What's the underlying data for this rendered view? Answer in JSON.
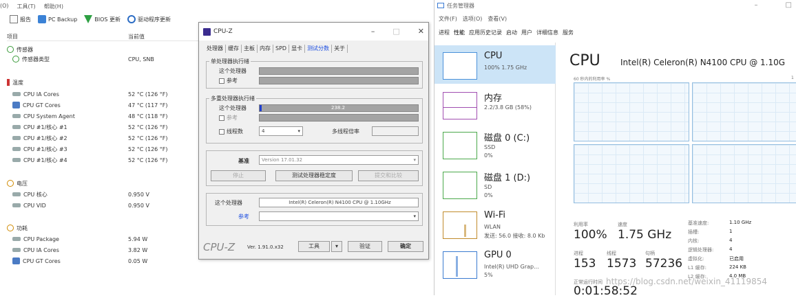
{
  "hwinfo": {
    "menu": [
      "(O)",
      "工具(T)",
      "帮助(H)"
    ],
    "toolbar": [
      "报告",
      "PC Backup",
      "BIOS 更新",
      "驱动程序更新"
    ],
    "col_item": "项目",
    "col_current": "当前值",
    "rows": [
      {
        "label": "传感器",
        "value": "",
        "icon": "sensor-icon",
        "level": 0
      },
      {
        "label": "传感器类型",
        "value": "CPU, SNB",
        "icon": "sensor-icon",
        "level": 1
      },
      {
        "label": "温度",
        "value": "",
        "icon": "thermometer-icon",
        "level": 0
      },
      {
        "label": "CPU IA Cores",
        "value": "52 °C (126 °F)",
        "icon": "cpu-chip-icon",
        "level": 1
      },
      {
        "label": "CPU GT Cores",
        "value": "47 °C (117 °F)",
        "icon": "gpu-icon",
        "level": 1
      },
      {
        "label": "CPU System Agent",
        "value": "48 °C (118 °F)",
        "icon": "cpu-chip-icon",
        "level": 1
      },
      {
        "label": "CPU #1/核心 #1",
        "value": "52 °C (126 °F)",
        "icon": "cpu-chip-icon",
        "level": 1
      },
      {
        "label": "CPU #1/核心 #2",
        "value": "52 °C (126 °F)",
        "icon": "cpu-chip-icon",
        "level": 1
      },
      {
        "label": "CPU #1/核心 #3",
        "value": "52 °C (126 °F)",
        "icon": "cpu-chip-icon",
        "level": 1
      },
      {
        "label": "CPU #1/核心 #4",
        "value": "52 °C (126 °F)",
        "icon": "cpu-chip-icon",
        "level": 1
      },
      {
        "label": "电压",
        "value": "",
        "icon": "voltage-icon",
        "level": 0
      },
      {
        "label": "CPU 核心",
        "value": "0.950 V",
        "icon": "cpu-chip-icon",
        "level": 1
      },
      {
        "label": "CPU VID",
        "value": "0.950 V",
        "icon": "cpu-chip-icon",
        "level": 1
      },
      {
        "label": "功耗",
        "value": "",
        "icon": "power-icon",
        "level": 0
      },
      {
        "label": "CPU Package",
        "value": "5.94 W",
        "icon": "cpu-chip-icon",
        "level": 1
      },
      {
        "label": "CPU IA Cores",
        "value": "3.82 W",
        "icon": "cpu-chip-icon",
        "level": 1
      },
      {
        "label": "CPU GT Cores",
        "value": "0.05 W",
        "icon": "gpu-icon",
        "level": 1
      }
    ]
  },
  "cpuz": {
    "title": "CPU-Z",
    "tabs": [
      "处理器",
      "缓存",
      "主板",
      "内存",
      "SPD",
      "显卡",
      "测试分数",
      "关于"
    ],
    "active_tab": "测试分数",
    "single_group": "单处理器执行绪",
    "this_processor": "这个处理器",
    "reference": "参考",
    "multi_group": "多重处理器执行绪",
    "multi_score": "238.2",
    "threads_label": "线程数",
    "threads_value": "4",
    "multi_ratio": "多线程倍率",
    "benchmark_label": "基准",
    "benchmark_value": "Version 17.01.32",
    "stop_btn": "停止",
    "bench_cpu_btn": "测试处理器稳定度",
    "submit_btn": "提交和比较",
    "this_proc_label": "这个处理器",
    "this_proc_value": "Intel(R) Celeron(R) N4100 CPU @ 1.10GHz",
    "ref_label": "参考",
    "footer_logo": "CPU-Z",
    "footer_ver": "Ver. 1.91.0.x32",
    "tools_btn": "工具",
    "validate_btn": "验证",
    "ok_btn": "确定"
  },
  "taskmgr": {
    "title": "任务管理器",
    "menu": [
      "文件(F)",
      "选项(O)",
      "查看(V)"
    ],
    "tabs": [
      "进程",
      "性能",
      "应用历史记录",
      "启动",
      "用户",
      "详细信息",
      "服务"
    ],
    "side": [
      {
        "name": "CPU",
        "l2": "100% 1.75 GHz",
        "l3": ""
      },
      {
        "name": "内存",
        "l2": "2.2/3.8 GB (58%)",
        "l3": ""
      },
      {
        "name": "磁盘 0 (C:)",
        "l2": "SSD",
        "l3": "0%"
      },
      {
        "name": "磁盘 1 (D:)",
        "l2": "SD",
        "l3": "0%"
      },
      {
        "name": "Wi-Fi",
        "l2": "WLAN",
        "l3": "发送: 56.0 接收: 8.0 Kb"
      },
      {
        "name": "GPU 0",
        "l2": "Intel(R) UHD Grap...",
        "l3": "5%"
      }
    ],
    "heading": "CPU",
    "model": "Intel(R) Celeron(R) N4100 CPU @ 1.10G",
    "util_label": "60 秒内的利用率 %",
    "util_max": "1",
    "stats": {
      "util_k": "利用率",
      "util_v": "100%",
      "speed_k": "速度",
      "speed_v": "1.75 GHz",
      "proc_k": "进程",
      "proc_v": "153",
      "thr_k": "线程",
      "thr_v": "1573",
      "hdl_k": "句柄",
      "hdl_v": "57236",
      "up_k": "正常运行时间",
      "up_v": "0:01:58:52"
    },
    "right": [
      {
        "k": "基准速度:",
        "v": "1.10 GHz"
      },
      {
        "k": "插槽:",
        "v": "1"
      },
      {
        "k": "内核:",
        "v": "4"
      },
      {
        "k": "逻辑处理器:",
        "v": "4"
      },
      {
        "k": "虚拟化:",
        "v": "已启用"
      },
      {
        "k": "L1 缓存:",
        "v": "224 KB"
      },
      {
        "k": "L2 缓存:",
        "v": "4.0 MB"
      }
    ]
  },
  "watermark": "https://blog.csdn.net/weixin_41119854"
}
